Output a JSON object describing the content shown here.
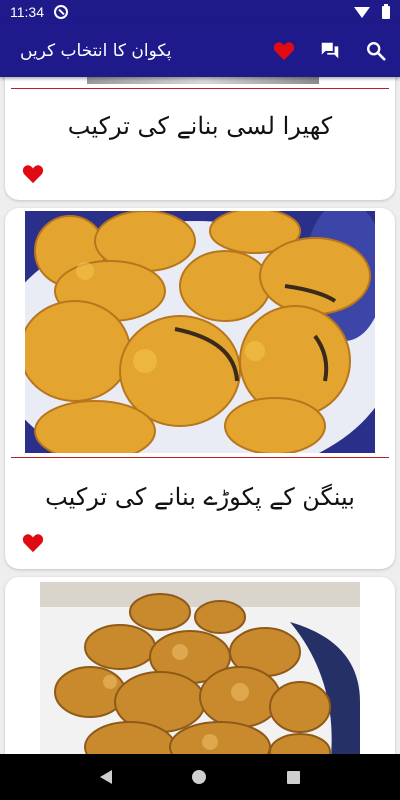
{
  "status_bar": {
    "time": "11:34"
  },
  "app_bar": {
    "title": "پکوان کا انتخاب کریں",
    "icons": [
      "favorite-heart-icon",
      "chat-icon",
      "search-icon"
    ]
  },
  "recipes": [
    {
      "title": "کھیرا لسی بنانے کی ترکیب",
      "favorite": true
    },
    {
      "title": "بینگن کے پکوڑے بنانے کی ترکیب",
      "favorite": true
    },
    {
      "title": "",
      "favorite": false
    }
  ],
  "colors": {
    "app_bar": "#1e1a8c",
    "accent_red": "#e00b12",
    "divider": "#c41a1a"
  }
}
